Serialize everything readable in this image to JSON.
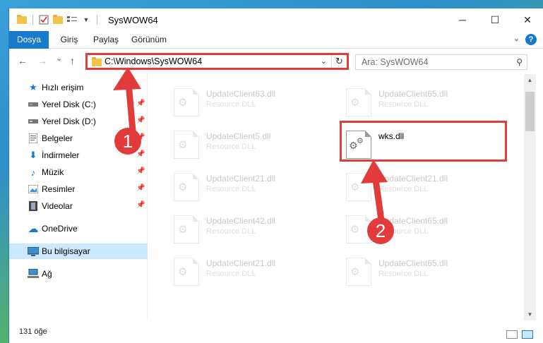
{
  "window": {
    "title": "SysWOW64",
    "controls": {
      "minimize": "─",
      "maximize": "☐",
      "close": "✕"
    }
  },
  "ribbon": {
    "tabs": [
      "Dosya",
      "Giriş",
      "Paylaş",
      "Görünüm"
    ],
    "help": "?",
    "accent": "#1979ca"
  },
  "nav": {
    "back": "←",
    "forward": "→",
    "recent": "⌄",
    "up": "↑",
    "address": "C:\\Windows\\SysWOW64",
    "search_placeholder": "Ara: SysWOW64"
  },
  "sidebar": {
    "items": [
      {
        "label": "Hızlı erişim",
        "icon": "star-icon",
        "pinned": false
      },
      {
        "label": "Yerel Disk (C:)",
        "icon": "drive-icon",
        "pinned": true
      },
      {
        "label": "Yerel Disk (D:)",
        "icon": "drive-icon",
        "pinned": true
      },
      {
        "label": "Belgeler",
        "icon": "documents-icon",
        "pinned": true
      },
      {
        "label": "İndirmeler",
        "icon": "download-icon",
        "pinned": true
      },
      {
        "label": "Müzik",
        "icon": "music-icon",
        "pinned": true
      },
      {
        "label": "Resimler",
        "icon": "pictures-icon",
        "pinned": true
      },
      {
        "label": "Videolar",
        "icon": "video-icon",
        "pinned": true
      },
      {
        "label": "OneDrive",
        "icon": "cloud-icon",
        "pinned": false
      },
      {
        "label": "Bu bilgisayar",
        "icon": "computer-icon",
        "pinned": false,
        "selected": true
      },
      {
        "label": "Ağ",
        "icon": "network-icon",
        "pinned": false
      }
    ]
  },
  "files": [
    {
      "name": "UpdateClient63.dll",
      "type": "Resource DLL",
      "faded": true
    },
    {
      "name": "UpdateClient65.dll",
      "type": "Resource DLL",
      "faded": true
    },
    {
      "name": "UpdateClient5.dll",
      "type": "Resource DLL",
      "faded": true
    },
    {
      "name": "wks.dll",
      "type": "",
      "faded": false
    },
    {
      "name": "UpdateClient21.dll",
      "type": "Resource DLL",
      "faded": true
    },
    {
      "name": "UpdateClient21.dll",
      "type": "Resource DLL",
      "faded": true
    },
    {
      "name": "UpdateClient42.dll",
      "type": "Resource DLL",
      "faded": true
    },
    {
      "name": "UpdateClient65.dll",
      "type": "Resource DLL",
      "faded": true
    },
    {
      "name": "UpdateClient21.dll",
      "type": "Resource DLL",
      "faded": true
    },
    {
      "name": "UpdateClient65.dll",
      "type": "Resource DLL",
      "faded": true
    }
  ],
  "status": {
    "count": "131 öğe"
  },
  "annotations": {
    "step1": "1",
    "step2": "2",
    "color": "#e23b3b"
  }
}
